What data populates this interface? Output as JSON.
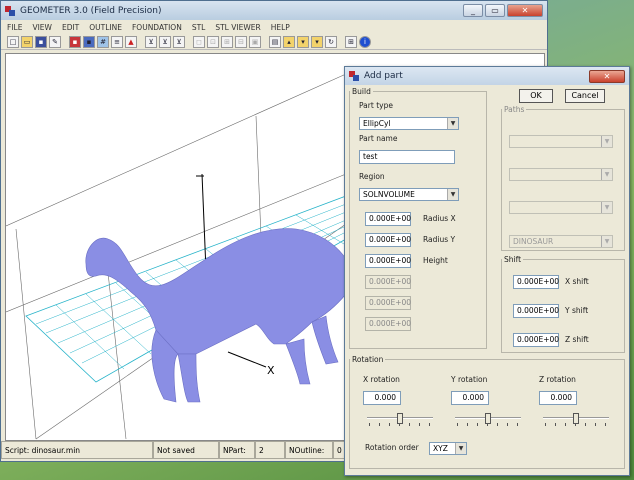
{
  "main_window": {
    "title": "GEOMETER 3.0 (Field Precision)",
    "min": "_",
    "max": "▭",
    "close": "✕"
  },
  "menu": [
    "FILE",
    "VIEW",
    "EDIT",
    "OUTLINE",
    "FOUNDATION",
    "STL",
    "STL VIEWER",
    "HELP"
  ],
  "viewport": {
    "axis_x_label": "X"
  },
  "status": {
    "script": "Script: dinosaur.min",
    "saved": "Not saved",
    "npart_label": "NPart:",
    "npart_value": "2",
    "noutline_label": "NOutline:",
    "noutline_value": "0"
  },
  "dialog": {
    "title": "Add part",
    "close": "✕",
    "ok": "OK",
    "cancel": "Cancel",
    "build": {
      "legend": "Build",
      "part_type_label": "Part type",
      "part_type_value": "EllipCyl",
      "part_name_label": "Part name",
      "part_name_value": "test",
      "region_label": "Region",
      "region_value": "SOLNVOLUME",
      "params": [
        {
          "value": "0.000E+00",
          "label": "Radius X",
          "enabled": true
        },
        {
          "value": "0.000E+00",
          "label": "Radius Y",
          "enabled": true
        },
        {
          "value": "0.000E+00",
          "label": "Height",
          "enabled": true
        },
        {
          "value": "0.000E+00",
          "label": "",
          "enabled": false
        },
        {
          "value": "0.000E+00",
          "label": "",
          "enabled": false
        },
        {
          "value": "0.000E+00",
          "label": "",
          "enabled": false
        }
      ]
    },
    "paths": {
      "legend": "Paths",
      "combo4": "DINOSAUR"
    },
    "shift": {
      "legend": "Shift",
      "x_value": "0.000E+00",
      "x_label": "X shift",
      "y_value": "0.000E+00",
      "y_label": "Y shift",
      "z_value": "0.000E+00",
      "z_label": "Z shift"
    },
    "rotation": {
      "legend": "Rotation",
      "x_label": "X rotation",
      "x_value": "0.000",
      "y_label": "Y rotation",
      "y_value": "0.000",
      "z_label": "Z rotation",
      "z_value": "0.000",
      "order_label": "Rotation order",
      "order_value": "XYZ"
    }
  }
}
